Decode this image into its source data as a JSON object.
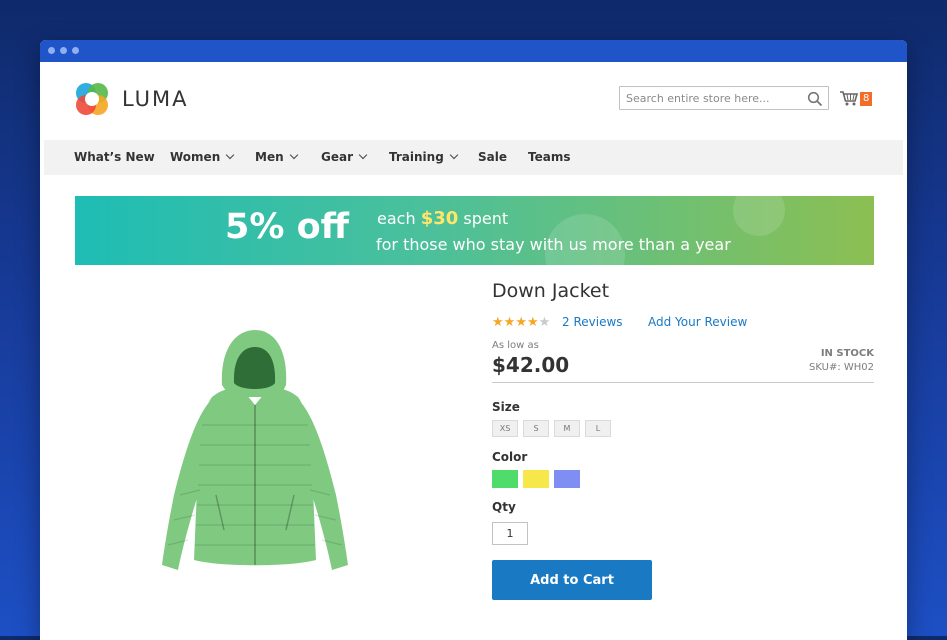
{
  "brand": {
    "name": "LUMA"
  },
  "search": {
    "placeholder": "Search entire store here..."
  },
  "cart": {
    "count": "8"
  },
  "nav": {
    "items": [
      {
        "label": "What’s New",
        "dropdown": false
      },
      {
        "label": "Women",
        "dropdown": true
      },
      {
        "label": "Men",
        "dropdown": true
      },
      {
        "label": "Gear",
        "dropdown": true
      },
      {
        "label": "Training",
        "dropdown": true
      },
      {
        "label": "Sale",
        "dropdown": false
      },
      {
        "label": "Teams",
        "dropdown": false
      }
    ]
  },
  "promo": {
    "discount": "5% off",
    "each": "each",
    "amount": "$30",
    "spent": "spent",
    "subtitle": "for those who stay with us more than a year"
  },
  "product": {
    "title": "Down Jacket",
    "rating": 4,
    "rating_max": 5,
    "reviews_link": "2 Reviews",
    "add_review_link": "Add Your Review",
    "price_prefix": "As low as",
    "price": "$42.00",
    "stock": "IN STOCK",
    "sku": "SKU#: WH02",
    "size_label": "Size",
    "sizes": [
      "XS",
      "S",
      "M",
      "L"
    ],
    "color_label": "Color",
    "colors": [
      "#4fdc6a",
      "#f6e84a",
      "#7f8ef2"
    ],
    "jacket_color": "#7fca80",
    "qty_label": "Qty",
    "qty": "1",
    "add_to_cart": "Add to Cart"
  },
  "theme": {
    "accent": "#1979c3",
    "badge": "#f26c2a"
  }
}
